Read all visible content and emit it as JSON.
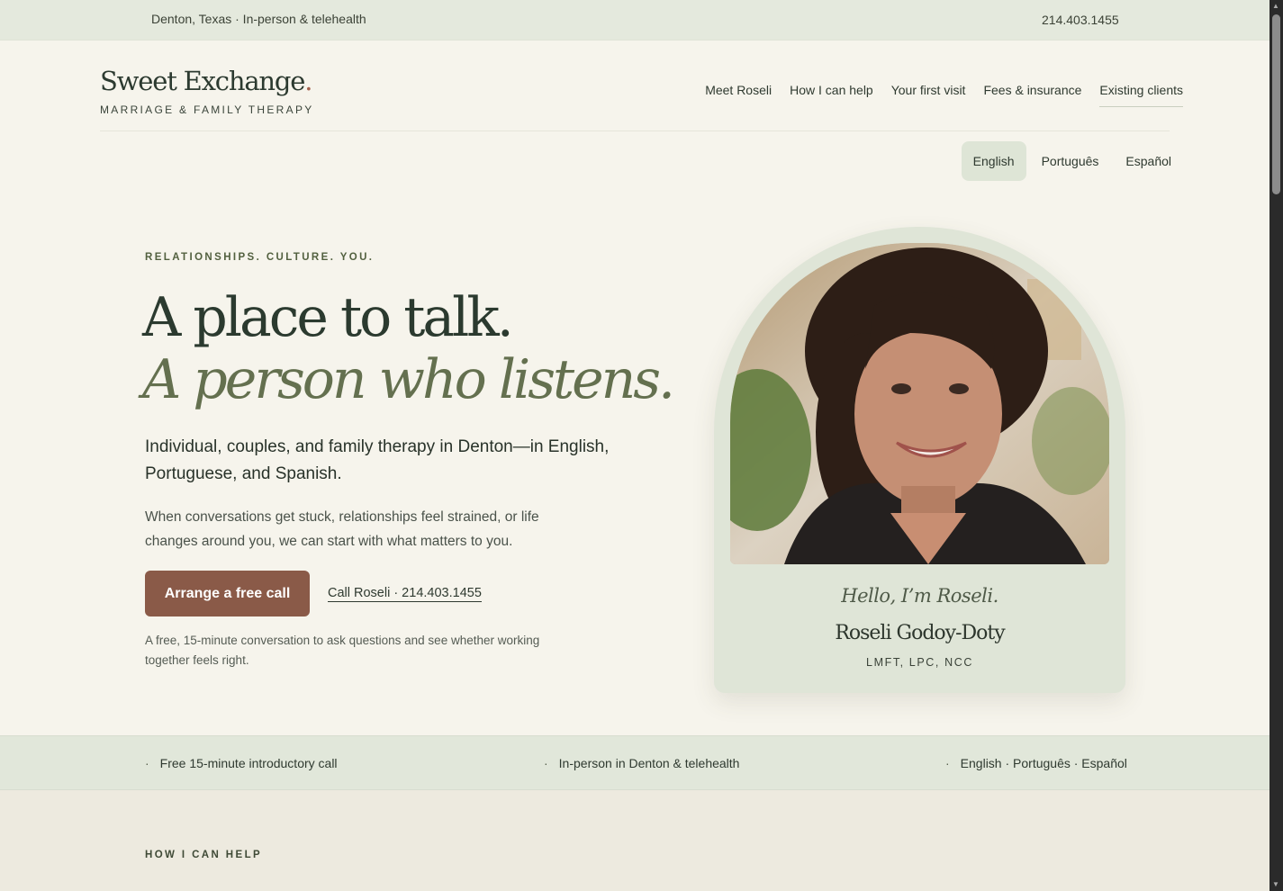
{
  "topbar": {
    "location": "Denton, Texas · In-person & telehealth",
    "phone": "214.403.1455"
  },
  "brand": {
    "name": "Sweet Exchange",
    "dot": ".",
    "subtitle": "MARRIAGE & FAMILY THERAPY"
  },
  "nav": {
    "items": [
      "Meet Roseli",
      "How I can help",
      "Your first visit",
      "Fees & insurance",
      "Existing clients"
    ]
  },
  "languages": {
    "options": [
      "English",
      "Português",
      "Español"
    ],
    "active": "English"
  },
  "hero": {
    "eyebrow": "RELATIONSHIPS. CULTURE. YOU.",
    "headline_1": "A place to talk.",
    "headline_2": "A person who listens.",
    "lead": "Individual, couples, and family therapy in Denton—in English, Portuguese, and Spanish.",
    "body": "When conversations get stuck, relationships feel strained, or life changes around you, we can start with what matters to you.",
    "cta": "Arrange a free call",
    "call_link": "Call Roseli · 214.403.1455",
    "note": "A free, 15-minute conversation to ask questions and see whether working together feels right."
  },
  "profile": {
    "hello": "Hello, I’m Roseli.",
    "name": "Roseli Godoy-Doty",
    "credentials": "LMFT, LPC, NCC"
  },
  "features": [
    "Free 15-minute introductory call",
    "In-person in Denton & telehealth",
    "English · Português · Español"
  ],
  "section_next": {
    "eyebrow": "HOW I CAN HELP"
  },
  "colors": {
    "background": "#f6f4ec",
    "topbar": "#e4e9dd",
    "accent_button": "#8a5a48",
    "headline_italic": "#64704f",
    "card": "#dfe5d7"
  }
}
